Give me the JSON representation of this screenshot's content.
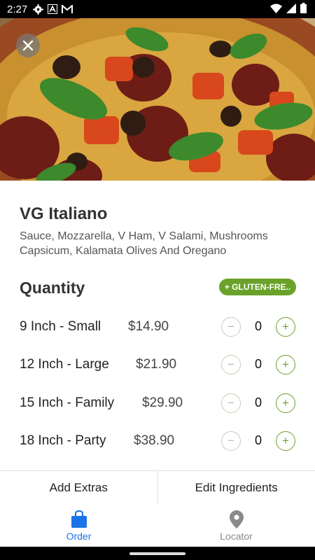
{
  "status": {
    "time": "2:27"
  },
  "product": {
    "title": "VG Italiano",
    "description": "Sauce, Mozzarella, V Ham, V Salami, Mushrooms Capsicum, Kalamata Olives And Oregano"
  },
  "quantity": {
    "heading": "Quantity",
    "badge": "+ GLUTEN-FRE..",
    "sizes": [
      {
        "name": "9 Inch - Small",
        "price": "$14.90",
        "count": "0"
      },
      {
        "name": "12 Inch - Large",
        "price": "$21.90",
        "count": "0"
      },
      {
        "name": "15 Inch - Family",
        "price": "$29.90",
        "count": "0"
      },
      {
        "name": "18 Inch - Party",
        "price": "$38.90",
        "count": "0"
      }
    ],
    "minus": "−",
    "plus": "+"
  },
  "actions": {
    "add_extras": "Add Extras",
    "edit_ingredients": "Edit Ingredients"
  },
  "nav": {
    "order": "Order",
    "locator": "Locator"
  },
  "colors": {
    "accent_green": "#6aa229",
    "nav_active": "#1a73e8",
    "nav_inactive": "#8a8a8a"
  },
  "icons": [
    "settings-icon",
    "a-icon",
    "gmail-icon",
    "wifi-icon",
    "signal-icon",
    "battery-icon",
    "close-icon",
    "shopping-bag-icon",
    "location-pin-icon"
  ]
}
